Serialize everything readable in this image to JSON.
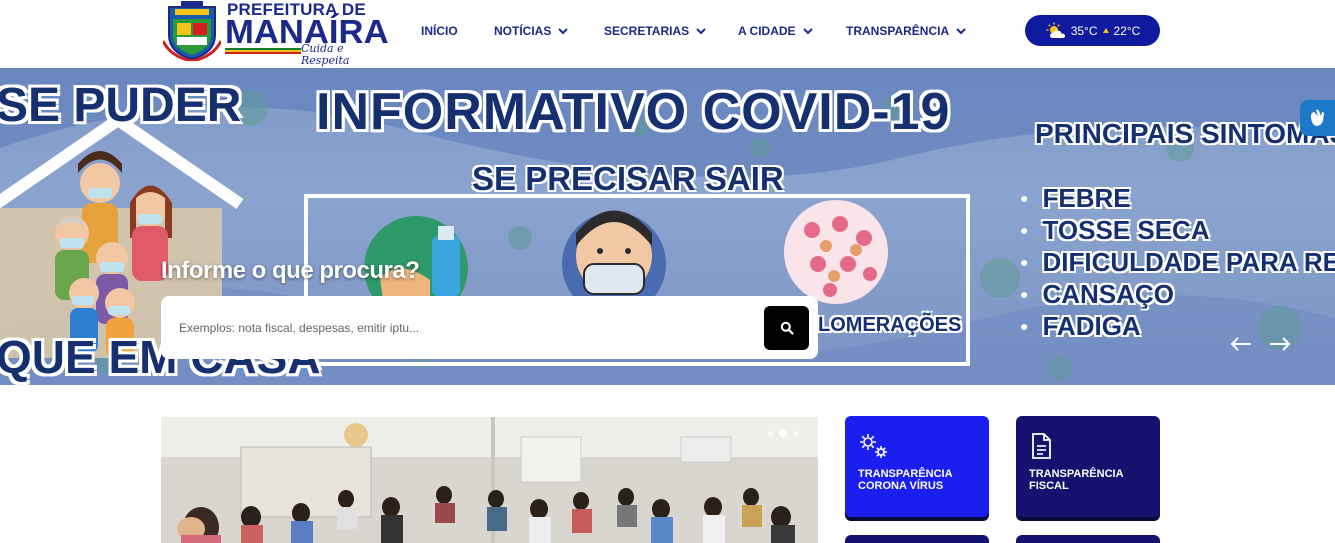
{
  "brand": {
    "line1": "PREFEITURA DE",
    "line2": "MANAÍRA",
    "tagline": "Cuida e Respeita",
    "colors": {
      "primary": "#1b2a8a",
      "stripes": [
        "#1a7a2e",
        "#f2c318",
        "#d3201e"
      ]
    }
  },
  "nav": {
    "items": [
      {
        "label": "INÍCIO",
        "has_dropdown": false
      },
      {
        "label": "NOTÍCIAS",
        "has_dropdown": true
      },
      {
        "label": "SECRETARIAS",
        "has_dropdown": true
      },
      {
        "label": "A CIDADE",
        "has_dropdown": true
      },
      {
        "label": "TRANSPARÊNCIA",
        "has_dropdown": true
      }
    ]
  },
  "weather": {
    "icon": "sun-cloud-icon",
    "max": "35°C",
    "min": "22°C"
  },
  "banner": {
    "title": "INFORMATIVO COVID-19",
    "left_text": "SE PUDER",
    "bottom_text": "QUE EM CASA",
    "subtitle": "SE PRECISAR SAIR",
    "agl_text": "LOMERAÇÕES",
    "symptoms_title": "PRINCIPAIS SINTOMAS",
    "symptoms": [
      "FEBRE",
      "TOSSE SECA",
      "DIFICULDADE PARA RESPIRAR",
      "CANSAÇO",
      "FADIGA"
    ]
  },
  "search": {
    "label": "Informe o que procura?",
    "placeholder": "Exemplos: nota fiscal, despesas, emitir iptu...",
    "value": ""
  },
  "carousel": {
    "slides": 2,
    "active": 1
  },
  "cards": [
    {
      "label": "TRANSPARÊNCIA CORONA VÍRUS",
      "icon": "gears-icon",
      "color": "#1a1ff0"
    },
    {
      "label": "TRANSPARÊNCIA FISCAL",
      "icon": "document-icon",
      "color": "#14126e"
    }
  ],
  "accessibility": {
    "icon": "sign-language-icon"
  }
}
